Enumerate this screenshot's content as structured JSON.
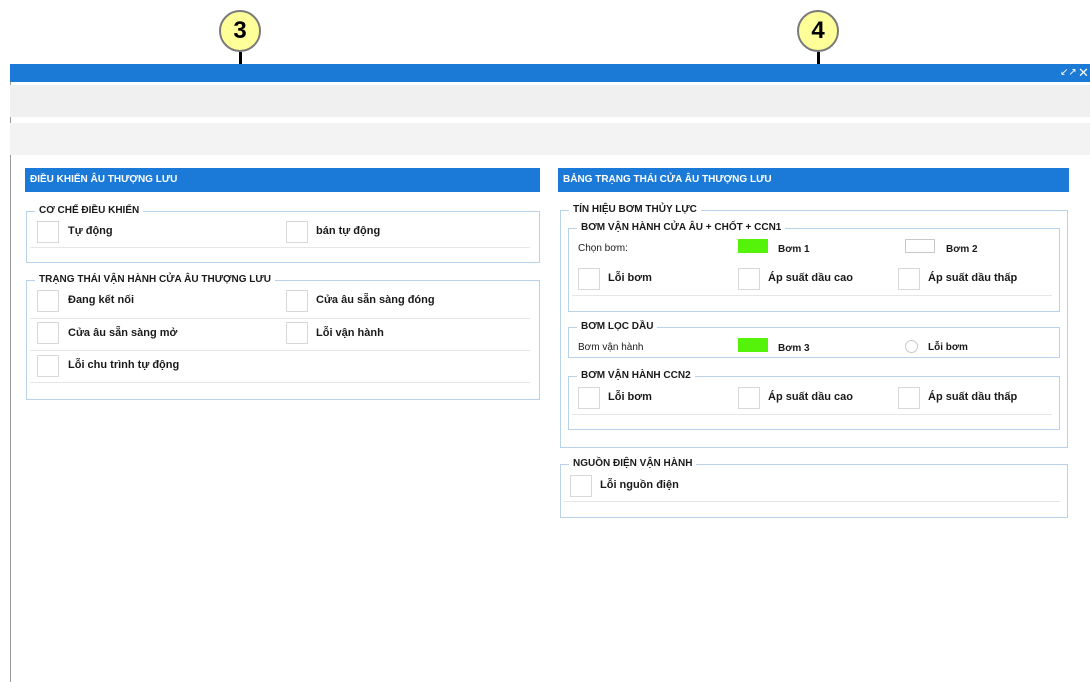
{
  "callouts": {
    "left": "3",
    "right": "4"
  },
  "window": {
    "restore_icon": "collapse-arrows-icon",
    "close_icon": "close-icon"
  },
  "left_panel": {
    "title": "ĐIỀU KHIỂN ÂU THƯỢNG LƯU",
    "control_mode": {
      "legend": "CƠ CHẾ ĐIỀU KHIỂN",
      "auto": "Tự động",
      "semi_auto": "bán tự động"
    },
    "status": {
      "legend": "TRẠNG THÁI VẬN HÀNH CỬA ÂU THƯỢNG LƯU",
      "connecting": "Đang kết nối",
      "ready_close": "Cửa âu sẵn sàng đóng",
      "ready_open": "Cửa âu sẵn sàng mở",
      "op_error": "Lỗi vận hành",
      "auto_cycle_error": "Lỗi chu trình tự động"
    }
  },
  "right_panel": {
    "title": "BẢNG TRẠNG THÁI CỬA ÂU THƯỢNG LƯU",
    "hydraulic": {
      "legend": "TÍN HIỆU BƠM THỦY LỰC",
      "gate_pump": {
        "legend": "BƠM VẬN HÀNH CỬA ÂU + CHỐT + CCN1",
        "select_label": "Chọn bơm:",
        "pump1": "Bơm 1",
        "pump2": "Bơm 2",
        "pump_error": "Lỗi bơm",
        "oil_high": "Áp suất dầu cao",
        "oil_low": "Áp suất dầu thấp"
      },
      "filter_pump": {
        "legend": "BƠM LỌC DẦU",
        "running_label": "Bơm vận hành",
        "pump3": "Bơm 3",
        "pump_error": "Lỗi bơm"
      },
      "ccn2_pump": {
        "legend": "BƠM VẬN HÀNH CCN2",
        "pump_error": "Lỗi bơm",
        "oil_high": "Áp suất dầu cao",
        "oil_low": "Áp suất dầu thấp"
      }
    },
    "power": {
      "legend": "NGUỒN ĐIỆN VẬN HÀNH",
      "power_error": "Lỗi nguồn điện"
    }
  },
  "colors": {
    "header_blue": "#1b7ad8",
    "indicator_on": "#55f30a",
    "group_border": "#b8d2ea"
  }
}
